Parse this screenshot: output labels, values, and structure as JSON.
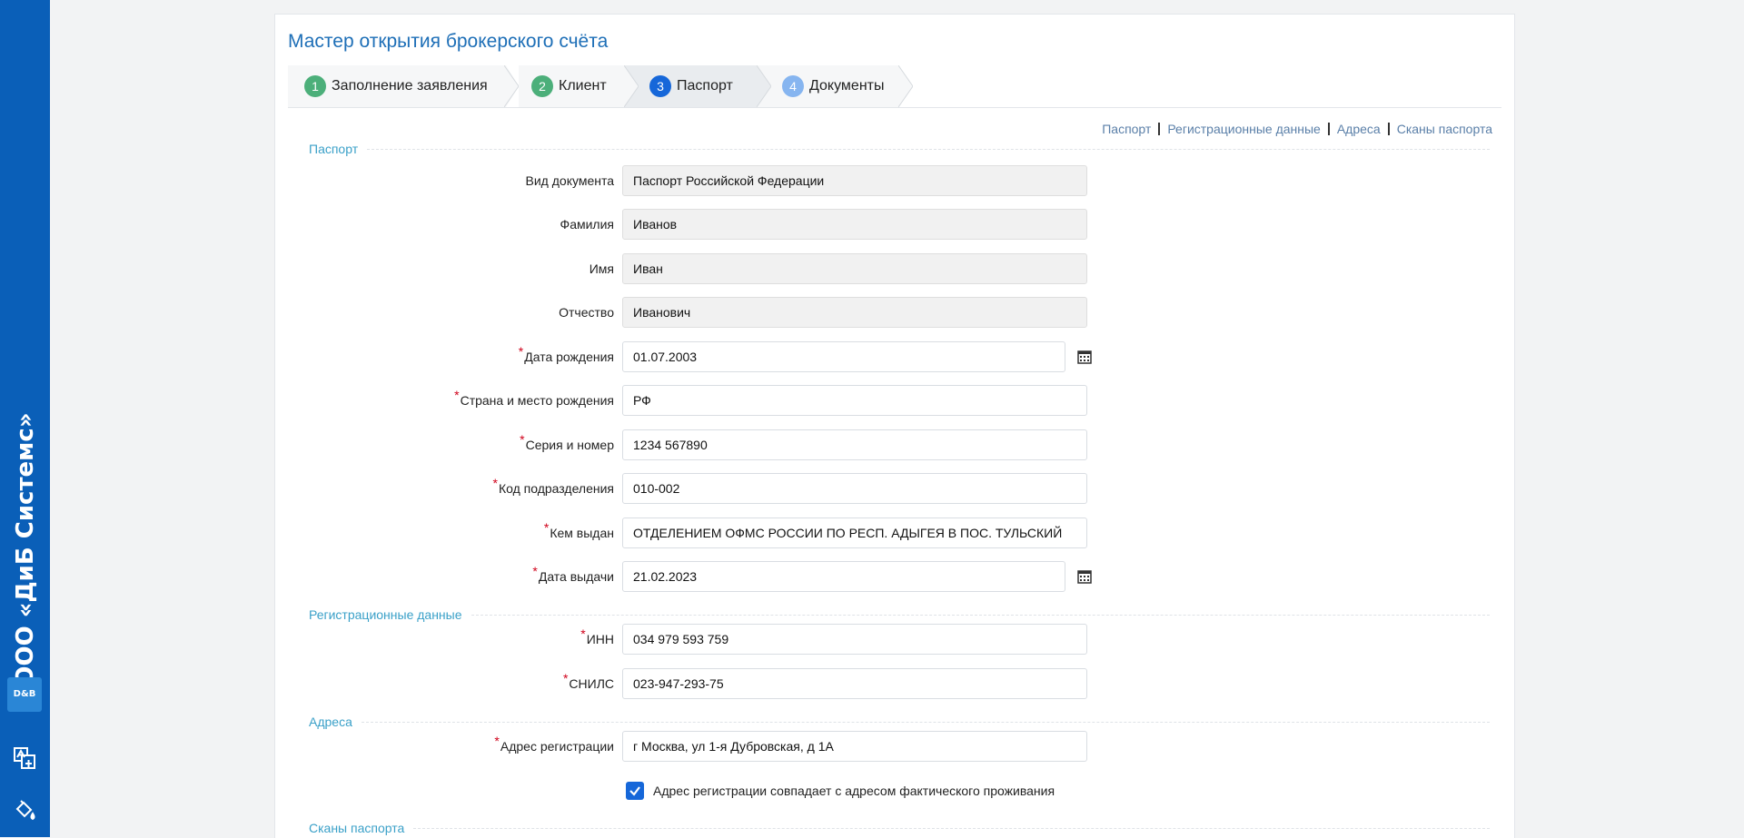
{
  "brand": {
    "company": "ООО «ДиБ Системс»",
    "logo_text": "D&B"
  },
  "colors": {
    "primary": "#0a5fb8",
    "accent": "#1667d9",
    "done": "#4caf7a",
    "required": "#d0021b"
  },
  "wizard": {
    "title": "Мастер открытия брокерского счёта",
    "steps": [
      {
        "num": "1",
        "label": "Заполнение заявления",
        "state": "done"
      },
      {
        "num": "2",
        "label": "Клиент",
        "state": "done"
      },
      {
        "num": "3",
        "label": "Паспорт",
        "state": "current"
      },
      {
        "num": "4",
        "label": "Документы",
        "state": "next"
      }
    ]
  },
  "anchors": [
    "Паспорт",
    "Регистрационные данные",
    "Адреса",
    "Сканы паспорта"
  ],
  "sections": {
    "passport": {
      "title": "Паспорт",
      "fields": [
        {
          "label": "Вид документа",
          "value": "Паспорт Российской Федерации",
          "required": false,
          "readonly": true
        },
        {
          "label": "Фамилия",
          "value": "Иванов",
          "required": false,
          "readonly": true
        },
        {
          "label": "Имя",
          "value": "Иван",
          "required": false,
          "readonly": true
        },
        {
          "label": "Отчество",
          "value": "Иванович",
          "required": false,
          "readonly": true
        },
        {
          "label": "Дата рождения",
          "value": "01.07.2003",
          "required": true,
          "date": true
        },
        {
          "label": "Страна и место рождения",
          "value": "РФ",
          "required": true
        },
        {
          "label": "Серия и номер",
          "value": "1234 567890",
          "required": true
        },
        {
          "label": "Код подразделения",
          "value": "010-002",
          "required": true
        },
        {
          "label": "Кем выдан",
          "value": "ОТДЕЛЕНИЕМ ОФМС РОССИИ ПО РЕСП. АДЫГЕЯ В ПОС. ТУЛЬСКИЙ",
          "required": true
        },
        {
          "label": "Дата выдачи",
          "value": "21.02.2023",
          "required": true,
          "date": true
        }
      ]
    },
    "registration": {
      "title": "Регистрационные данные",
      "fields": [
        {
          "label": "ИНН",
          "value": "034 979 593 759",
          "required": true
        },
        {
          "label": "СНИЛС",
          "value": "023-947-293-75",
          "required": true
        }
      ]
    },
    "addresses": {
      "title": "Адреса",
      "fields": [
        {
          "label": "Адрес регистрации",
          "value": "г Москва, ул 1-я Дубровская, д 1А",
          "required": true
        }
      ],
      "checkbox_label": "Адрес регистрации совпадает с адресом фактического проживания",
      "checkbox_checked": true
    },
    "scans": {
      "title": "Сканы паспорта"
    }
  },
  "required_mark": "*"
}
